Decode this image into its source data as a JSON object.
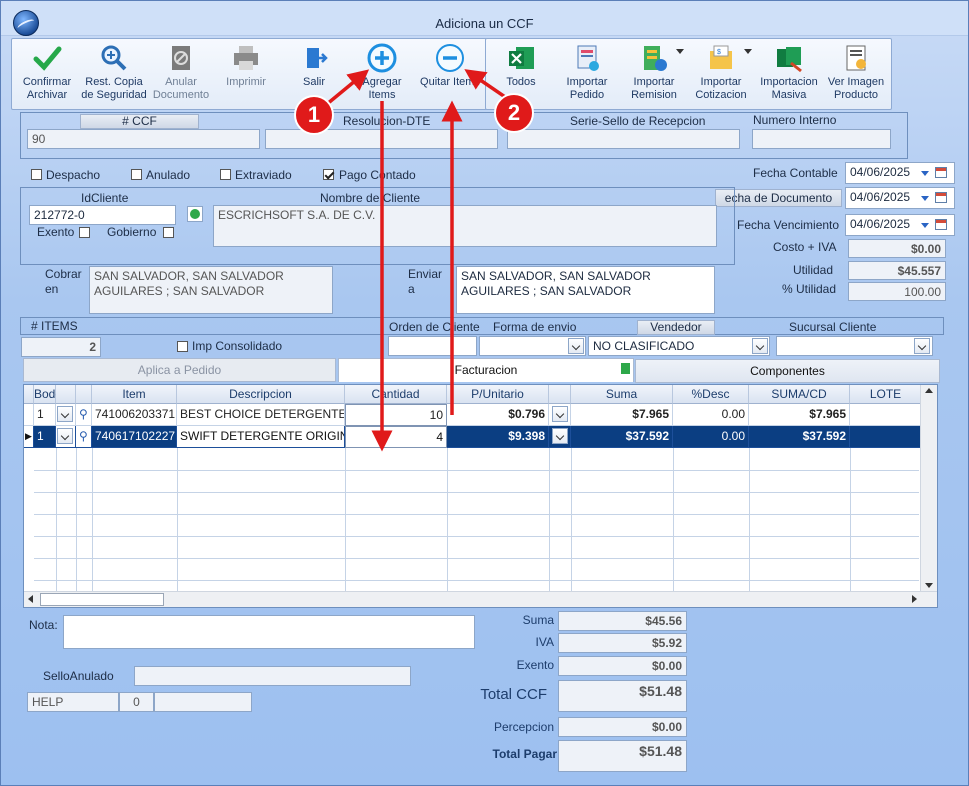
{
  "window": {
    "title": "Adiciona un CCF"
  },
  "toolbar": {
    "confirmar": "Confirmar Archivar",
    "restcopia": "Rest. Copia de Seguridad",
    "anular": "Anular Documento",
    "imprimir": "Imprimir",
    "salir": "Salir",
    "agregar": "Agregar Items",
    "quitar": "Quitar Items",
    "todos": "Todos",
    "importar_pedido": "Importar Pedido",
    "importar_remision": "Importar Remision",
    "importar_cotizacion": "Importar Cotizacion",
    "importacion_masiva": "Importacion Masiva",
    "ver_imagen": "Ver Imagen Producto"
  },
  "annotations": {
    "badge1": "1",
    "badge2": "2"
  },
  "header": {
    "ccf_label": "# CCF",
    "ccf_value": "90",
    "resolucion_label": "Resolucion-DTE",
    "resolucion_value": "",
    "serie_label": "Serie-Sello de Recepcion",
    "serie_value": "",
    "numero_label": "Numero Interno",
    "numero_value": ""
  },
  "flags": {
    "despacho": "Despacho",
    "anulado": "Anulado",
    "extraviado": "Extraviado",
    "pago_contado": "Pago Contado"
  },
  "dates": {
    "contable_label": "Fecha Contable",
    "contable": "04/06/2025",
    "documento_label": "echa de Documento",
    "documento": "04/06/2025",
    "vencimiento_label": "Fecha Vencimiento",
    "vencimiento": "04/06/2025"
  },
  "client": {
    "id_label": "IdCliente",
    "id_value": "212772-0",
    "nombre_label": "Nombre de Cliente",
    "nombre_value": "ESCRICHSOFT S.A. DE C.V.",
    "exento_label": "Exento",
    "gobierno_label": "Gobierno",
    "cobrar_label": "Cobrar en",
    "cobrar_value": "SAN SALVADOR, SAN SALVADOR AGUILARES ; SAN SALVADOR",
    "enviar_label": "Enviar a",
    "enviar_value": "SAN SALVADOR, SAN SALVADOR AGUILARES ; SAN SALVADOR"
  },
  "summary_right": {
    "costo_label": "Costo + IVA",
    "costo": "$0.00",
    "utilidad_label": "Utilidad",
    "utilidad": "$45.557",
    "putilidad_label": "% Utilidad",
    "putilidad": "100.00"
  },
  "meta": {
    "items_label": "# ITEMS",
    "items_value": "2",
    "imp_consolidado": "Imp Consolidado",
    "orden_label": "Orden de Cliente",
    "orden_value": "",
    "forma_label": "Forma de envio",
    "forma_value": "",
    "vendedor_label": "Vendedor",
    "vendedor_value": "NO CLASIFICADO",
    "sucursal_label": "Sucursal Cliente",
    "sucursal_value": ""
  },
  "tabs": [
    "Aplica a Pedido",
    "Facturacion",
    "Componentes"
  ],
  "grid": {
    "columns": [
      "Bodega",
      "",
      "Item",
      "Descripcion",
      "Cantidad",
      "P/Unitario",
      "",
      "Suma",
      "%Desc",
      "SUMA/CD",
      "LOTE"
    ],
    "rows": [
      {
        "bodega": "1",
        "item": "741006203371",
        "desc": "BEST CHOICE DETERGENTE",
        "cant": "10",
        "punit": "$0.796",
        "suma": "$7.965",
        "desc_pct": "0.00",
        "sumacd": "$7.965",
        "lote": ""
      },
      {
        "bodega": "1",
        "item": "740617102227",
        "desc": "SWIFT DETERGENTE ORIGINAL",
        "cant": "4",
        "punit": "$9.398",
        "suma": "$37.592",
        "desc_pct": "0.00",
        "sumacd": "$37.592",
        "lote": ""
      }
    ]
  },
  "footer": {
    "nota_label": "Nota:",
    "nota_value": "",
    "sello_label": "SelloAnulado",
    "sello_value": "",
    "help": "HELP",
    "help_count": "0",
    "help_extra": ""
  },
  "totals": {
    "suma_label": "Suma",
    "suma": "$45.56",
    "iva_label": "IVA",
    "iva": "$5.92",
    "exento_label": "Exento",
    "exento": "$0.00",
    "totalccf_label": "Total CCF",
    "totalccf": "$51.48",
    "percepcion_label": "Percepcion",
    "percepcion": "$0.00",
    "totalpagar_label": "Total Pagar",
    "totalpagar": "$51.48"
  }
}
